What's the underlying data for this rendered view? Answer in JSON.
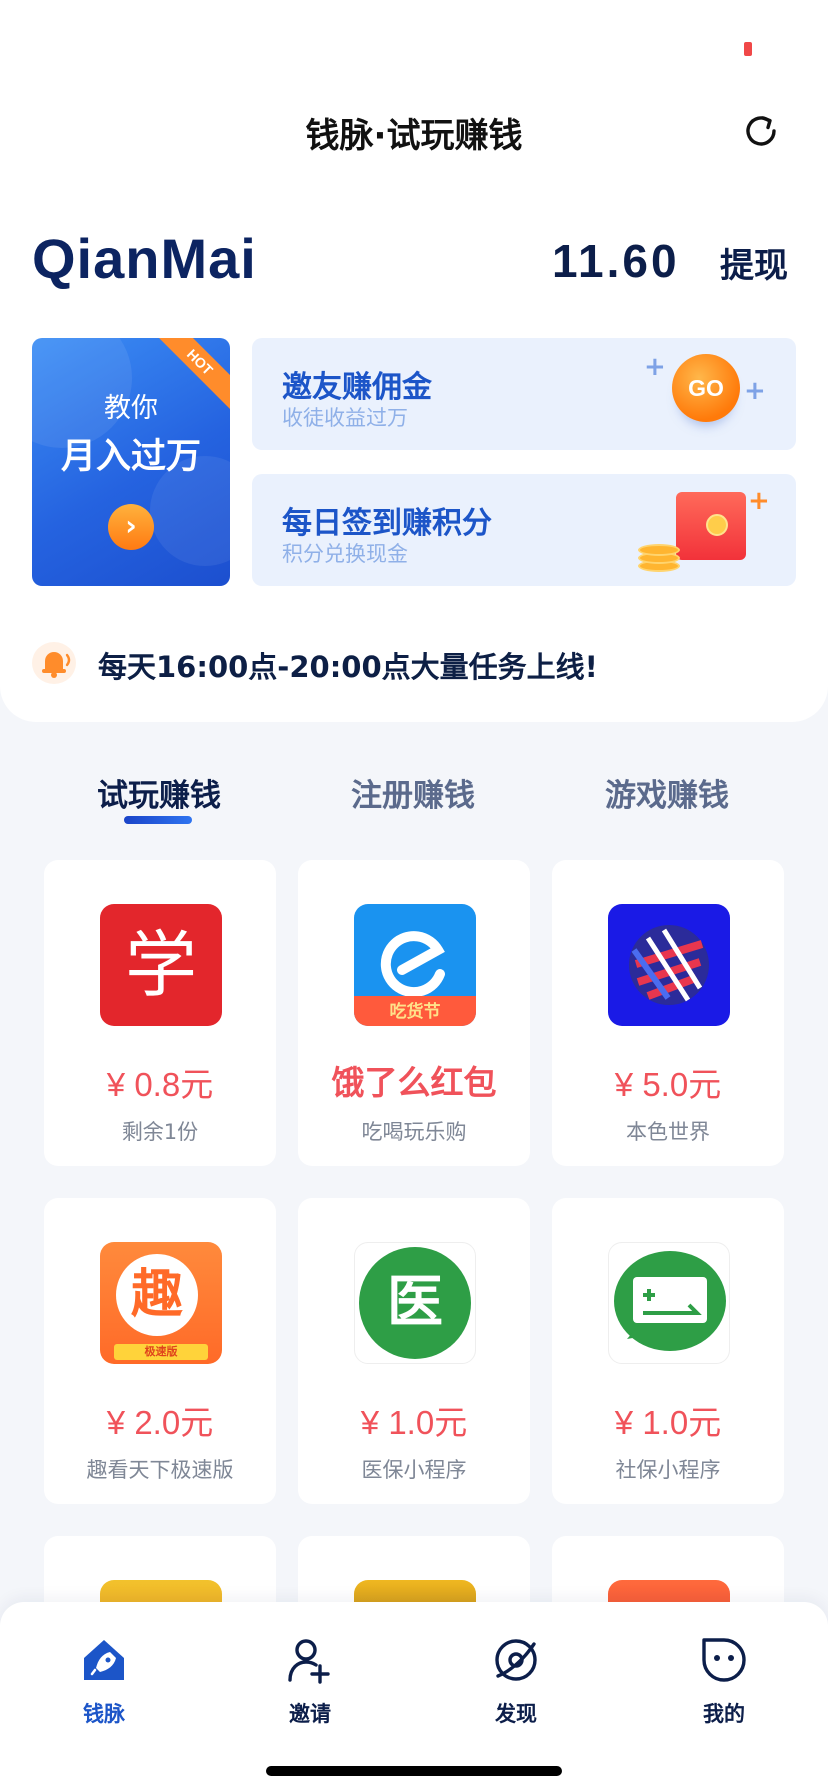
{
  "header": {
    "title": "钱脉·试玩赚钱"
  },
  "account": {
    "brand": "QianMai",
    "balance": "11.60",
    "withdraw_label": "提现"
  },
  "promos": {
    "big": {
      "badge": "HOT",
      "line1": "教你",
      "line2": "月入过万",
      "arrow": "›"
    },
    "invite": {
      "title": "邀友赚佣金",
      "subtitle": "收徒收益过万",
      "badge": "GO"
    },
    "checkin": {
      "title": "每日签到赚积分",
      "subtitle": "积分兑换现金"
    }
  },
  "notice": {
    "text": "每天16:00点-20:00点大量任务上线!"
  },
  "tabs": [
    {
      "label": "试玩赚钱",
      "active": true
    },
    {
      "label": "注册赚钱",
      "active": false
    },
    {
      "label": "游戏赚钱",
      "active": false
    }
  ],
  "tasks": [
    {
      "icon": "xue-app-icon",
      "price": "¥ 0.8元",
      "sub": "剩余1份",
      "icon_glyph": "学"
    },
    {
      "icon": "eleme-app-icon",
      "title": "饿了么红包",
      "sub": "吃喝玩乐购",
      "icon_caption": "吃货节"
    },
    {
      "icon": "bense-world-app-icon",
      "price": "¥ 5.0元",
      "sub": "本色世界"
    },
    {
      "icon": "qukan-app-icon",
      "price": "¥ 2.0元",
      "sub": "趣看天下极速版",
      "icon_glyph": "趣",
      "icon_caption": "极速版"
    },
    {
      "icon": "medical-insurance-icon",
      "price": "¥ 1.0元",
      "sub": "医保小程序",
      "icon_glyph": "医"
    },
    {
      "icon": "social-insurance-icon",
      "price": "¥ 1.0元",
      "sub": "社保小程序"
    }
  ],
  "bottom_nav": [
    {
      "label": "钱脉",
      "icon": "rocket-home-icon",
      "active": true
    },
    {
      "label": "邀请",
      "icon": "add-user-icon",
      "active": false
    },
    {
      "label": "发现",
      "icon": "discover-icon",
      "active": false
    },
    {
      "label": "我的",
      "icon": "profile-face-icon",
      "active": false
    }
  ],
  "colors": {
    "accent": "#1c55c8",
    "price_red": "#f0525a",
    "brand_navy": "#0c2461",
    "orange": "#ff8c2b"
  }
}
